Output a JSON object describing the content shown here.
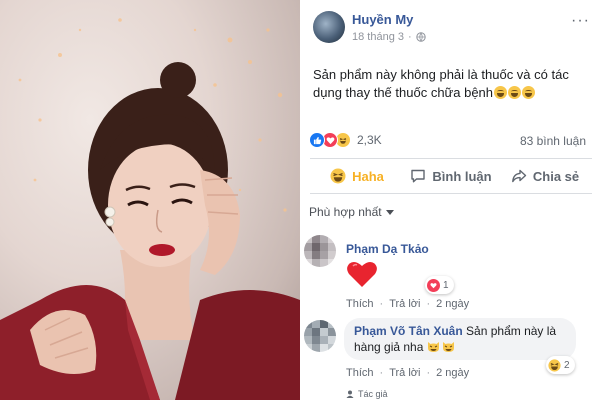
{
  "post": {
    "author": "Huyền My",
    "date": "18 tháng 3",
    "dot": "·",
    "text": "Sản phẩm này không phải là thuốc và có tác dụng thay thế thuốc chữa bệnh",
    "more": "···"
  },
  "stats": {
    "reaction_count": "2,3K",
    "comment_count": "83 bình luận"
  },
  "actions": {
    "haha": "Haha",
    "comment": "Bình luận",
    "share": "Chia sẻ"
  },
  "filter": {
    "label": "Phù hợp nhất"
  },
  "comments": [
    {
      "name": "Phạm Dạ Tkảo",
      "reaction_count": "1",
      "like": "Thích",
      "reply": "Trả lời",
      "dot": "·",
      "time": "2 ngày"
    },
    {
      "name": "Phạm Võ Tân Xuân",
      "text": "Sản phẩm này là hàng giả nha",
      "reaction_count": "2",
      "like": "Thích",
      "reply": "Trả lời",
      "dot": "·",
      "time": "2 ngày"
    }
  ],
  "author_tag": "Tác giả",
  "colors": {
    "link": "#385898",
    "haha_active": "#f7b125",
    "like_blue": "#1877f2",
    "love_red": "#f33e58",
    "haha_yellow": "#f7c64a",
    "jacket": "#8e1f2a"
  },
  "icons": {
    "globe": "globe-icon",
    "more": "more-icon",
    "haha": "haha-icon",
    "comment": "comment-icon",
    "share": "share-icon",
    "heart": "heart-icon"
  }
}
